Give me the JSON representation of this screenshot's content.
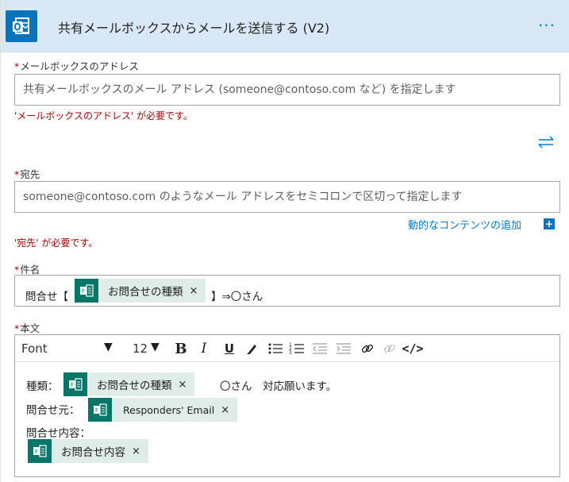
{
  "header": {
    "title": "共有メールボックスからメールを送信する (V2)",
    "more_label": "···",
    "app_icon": "outlook-icon",
    "colors": {
      "bar": "#d9e8f6",
      "icon": "#0a74ba",
      "accent": "#0078d4"
    }
  },
  "mailbox": {
    "req": "*",
    "label": "メールボックスのアドレス",
    "placeholder": "共有メールボックスのメール アドレス (someone@contoso.com など) を指定します",
    "error": "'メールボックスのアドレス' が必要です。"
  },
  "swap_icon": "swap-arrows-icon",
  "to": {
    "req": "*",
    "label": "宛先",
    "placeholder": "someone@contoso.com のようなメール アドレスをセミコロンで区切って指定します",
    "dynamic_link": "動的なコンテンツの追加",
    "dynamic_plus": "+",
    "error": "'宛先' が必要です。"
  },
  "subject": {
    "req": "*",
    "label": "件名",
    "prefix": "問合せ【",
    "token": {
      "label": "お問合せの種類",
      "close": "×"
    },
    "suffix": "】⇒〇さん"
  },
  "body": {
    "req": "*",
    "label": "本文",
    "toolbar": {
      "font": "Font",
      "font_arrow": "▼",
      "size": "12",
      "size_arrow": "▼",
      "bold": "B",
      "italic": "I",
      "underline": "U",
      "code": "</>"
    },
    "line1_label": "種類：",
    "line1_token": {
      "label": "お問合せの種類",
      "close": "×"
    },
    "line1_after": "〇さん　対応願います。",
    "line2_label": "問合せ元：",
    "line2_token": {
      "label": "Responders' Email",
      "close": "×"
    },
    "line3_label": "問合せ内容：",
    "line4_token": {
      "label": "お問合せ内容",
      "close": "×"
    },
    "token_color": "#077568"
  }
}
